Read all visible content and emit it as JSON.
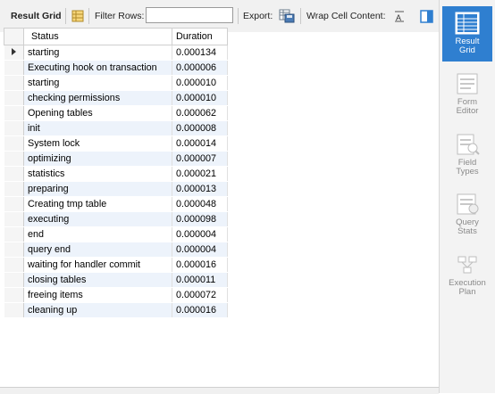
{
  "toolbar": {
    "result_grid_label": "Result Grid",
    "filter_rows_label": "Filter Rows:",
    "filter_value": "",
    "export_label": "Export:",
    "wrap_label": "Wrap Cell Content:"
  },
  "table": {
    "columns": [
      "Status",
      "Duration"
    ],
    "rows": [
      [
        "starting",
        "0.000134"
      ],
      [
        "Executing hook on transaction",
        "0.000006"
      ],
      [
        "starting",
        "0.000010"
      ],
      [
        "checking permissions",
        "0.000010"
      ],
      [
        "Opening tables",
        "0.000062"
      ],
      [
        "init",
        "0.000008"
      ],
      [
        "System lock",
        "0.000014"
      ],
      [
        "optimizing",
        "0.000007"
      ],
      [
        "statistics",
        "0.000021"
      ],
      [
        "preparing",
        "0.000013"
      ],
      [
        "Creating tmp table",
        "0.000048"
      ],
      [
        "executing",
        "0.000098"
      ],
      [
        "end",
        "0.000004"
      ],
      [
        "query end",
        "0.000004"
      ],
      [
        "waiting for handler commit",
        "0.000016"
      ],
      [
        "closing tables",
        "0.000011"
      ],
      [
        "freeing items",
        "0.000072"
      ],
      [
        "cleaning up",
        "0.000016"
      ]
    ]
  },
  "sidebar": {
    "items": [
      {
        "label1": "Result",
        "label2": "Grid",
        "icon": "result-grid-icon",
        "active": true
      },
      {
        "label1": "Form",
        "label2": "Editor",
        "icon": "form-editor-icon",
        "active": false
      },
      {
        "label1": "Field",
        "label2": "Types",
        "icon": "field-types-icon",
        "active": false
      },
      {
        "label1": "Query",
        "label2": "Stats",
        "icon": "query-stats-icon",
        "active": false
      },
      {
        "label1": "Execution",
        "label2": "Plan",
        "icon": "execution-plan-icon",
        "active": false
      }
    ]
  },
  "colors": {
    "accent": "#2f7fd0",
    "alt_row": "#edf3fb"
  }
}
